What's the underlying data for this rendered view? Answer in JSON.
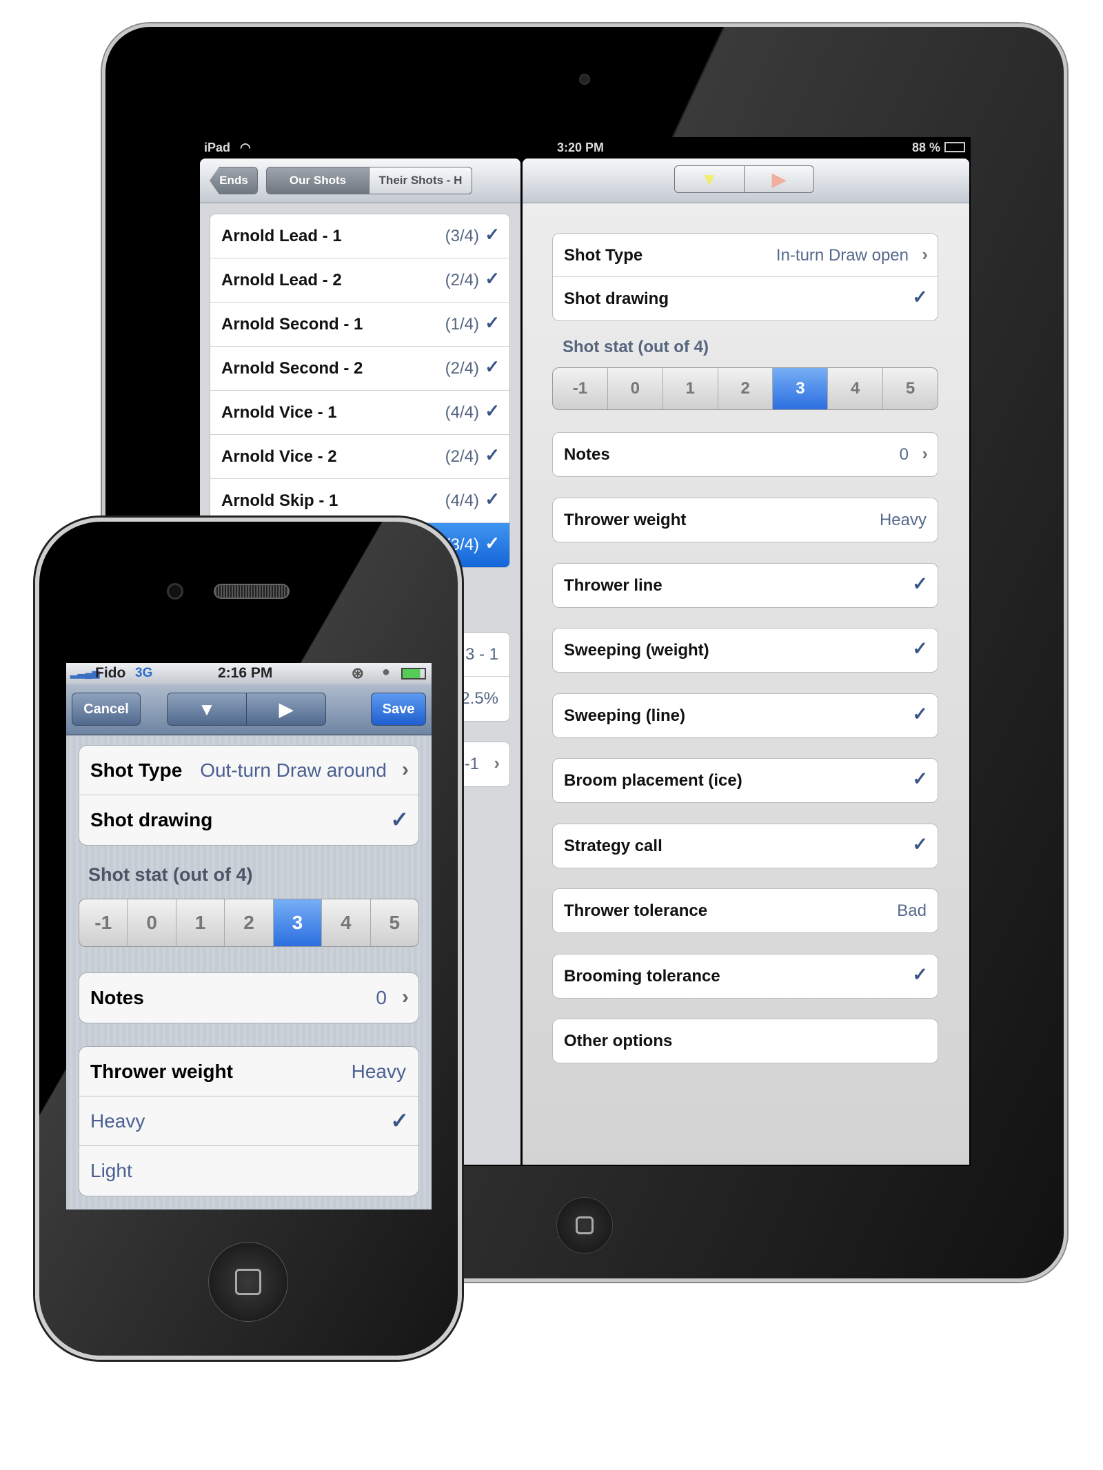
{
  "ipad": {
    "status": {
      "carrier": "iPad",
      "time": "3:20 PM",
      "battery": "88 %"
    },
    "left_nav": {
      "back": "Ends",
      "seg_active": "Our Shots",
      "seg_other": "Their Shots - H"
    },
    "shots": [
      {
        "label": "Arnold Lead - 1",
        "count": "(3/4)",
        "selected": false
      },
      {
        "label": "Arnold Lead - 2",
        "count": "(2/4)",
        "selected": false
      },
      {
        "label": "Arnold Second - 1",
        "count": "(1/4)",
        "selected": false
      },
      {
        "label": "Arnold Second - 2",
        "count": "(2/4)",
        "selected": false
      },
      {
        "label": "Arnold Vice - 1",
        "count": "(4/4)",
        "selected": false
      },
      {
        "label": "Arnold Vice - 2",
        "count": "(2/4)",
        "selected": false
      },
      {
        "label": "Arnold Skip - 1",
        "count": "(4/4)",
        "selected": false
      },
      {
        "label": "",
        "count": "(3/4)",
        "selected": true
      }
    ],
    "summary_values": [
      "3 - 1",
      "2.5%"
    ],
    "summary_nav_value": "-1",
    "right": {
      "shot_type_label": "Shot Type",
      "shot_type_value": "In-turn Draw open",
      "shot_drawing_label": "Shot drawing",
      "stat_label": "Shot stat (out of 4)",
      "stat_options": [
        "-1",
        "0",
        "1",
        "2",
        "3",
        "4",
        "5"
      ],
      "stat_selected": "3",
      "notes_label": "Notes",
      "notes_value": "0",
      "rows": [
        {
          "label": "Thrower weight",
          "value": "Heavy"
        },
        {
          "label": "Thrower line",
          "value": "",
          "checked": true
        },
        {
          "label": "Sweeping (weight)",
          "value": "",
          "checked": true
        },
        {
          "label": "Sweeping (line)",
          "value": "",
          "checked": true
        },
        {
          "label": "Broom placement (ice)",
          "value": "",
          "checked": true
        },
        {
          "label": "Strategy call",
          "value": "",
          "checked": true
        },
        {
          "label": "Thrower tolerance",
          "value": "Bad"
        },
        {
          "label": "Brooming tolerance",
          "value": "",
          "checked": true
        },
        {
          "label": "Other options",
          "value": ""
        }
      ]
    }
  },
  "iphone": {
    "status": {
      "carrier": "Fido",
      "network": "3G",
      "time": "2:16 PM"
    },
    "nav": {
      "cancel": "Cancel",
      "save": "Save"
    },
    "shot_type_label": "Shot Type",
    "shot_type_value": "Out-turn Draw around",
    "shot_drawing_label": "Shot drawing",
    "stat_label": "Shot stat (out of 4)",
    "stat_options": [
      "-1",
      "0",
      "1",
      "2",
      "3",
      "4",
      "5"
    ],
    "stat_selected": "3",
    "notes_label": "Notes",
    "notes_value": "0",
    "weight_label": "Thrower weight",
    "weight_value": "Heavy",
    "weight_options": [
      {
        "label": "Heavy",
        "checked": true
      },
      {
        "label": "Light",
        "checked": false
      }
    ]
  },
  "colors": {
    "accent": "#2c6fe0",
    "value_text": "#56698c",
    "check": "#3a5586"
  }
}
